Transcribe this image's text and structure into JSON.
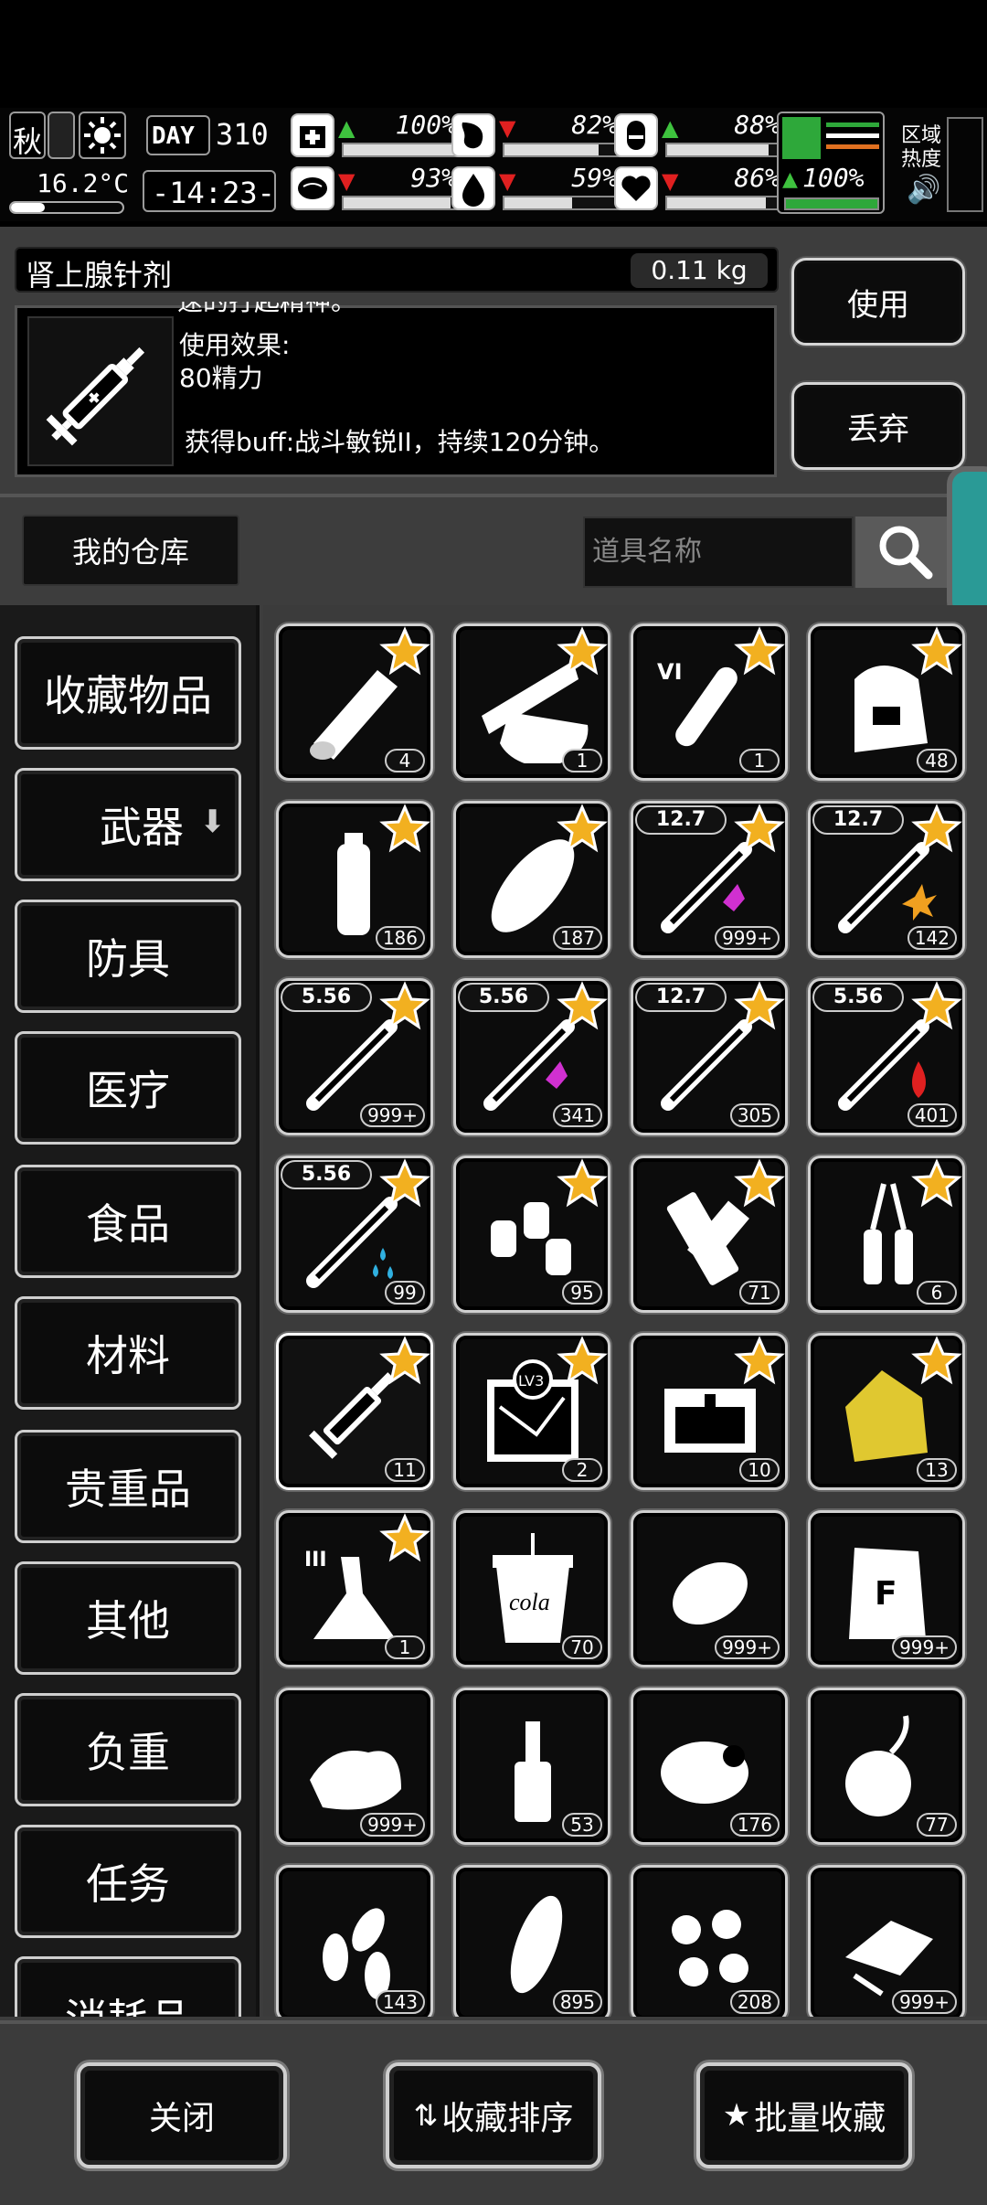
{
  "status": {
    "season": "秋",
    "weather_icon": "sun-icon",
    "temperature": "16.2°C",
    "day_label": "DAY",
    "day": "310",
    "time": "-14:23-",
    "stats": [
      {
        "name": "health",
        "icon": "medkit-icon",
        "trend": "up",
        "value": "100%",
        "fill": 1.0
      },
      {
        "name": "hunger",
        "icon": "stomach-icon",
        "trend": "down",
        "value": "82%",
        "fill": 0.82
      },
      {
        "name": "pill",
        "icon": "pill-icon",
        "trend": "up",
        "value": "88%",
        "fill": 0.88
      },
      {
        "name": "brain",
        "icon": "brain-icon",
        "trend": "down",
        "value": "93%",
        "fill": 0.93
      },
      {
        "name": "water",
        "icon": "water-drop-icon",
        "trend": "down",
        "value": "59%",
        "fill": 0.59
      },
      {
        "name": "mood",
        "icon": "heart-icon",
        "trend": "down",
        "value": "86%",
        "fill": 0.86
      }
    ],
    "stamina": {
      "value": "100%",
      "fill": 1.0
    },
    "zone_label_1": "区域",
    "zone_label_2": "热度"
  },
  "item": {
    "name": "肾上腺针剂",
    "weight": "0.11 kg",
    "desc_partial": "速的打起精神。",
    "effect_label": "使用效果:",
    "effect_value": "80精力",
    "buff": "获得buff:战斗敏锐II，持续120分钟。",
    "use_label": "使用",
    "discard_label": "丢弃"
  },
  "search": {
    "warehouse_label": "我的仓库",
    "placeholder": "道具名称"
  },
  "categories": [
    "收藏物品",
    "武器",
    "防具",
    "医疗",
    "食品",
    "材料",
    "贵重品",
    "其他",
    "负重",
    "任务",
    "消耗品"
  ],
  "grid": [
    {
      "icon": "wood-log-icon",
      "count": "4",
      "star": true
    },
    {
      "icon": "wood-planks-icon",
      "count": "1",
      "star": true
    },
    {
      "icon": "test-tube-icon",
      "count": "1",
      "star": true,
      "tag": "VI"
    },
    {
      "icon": "backpack-icon",
      "count": "48",
      "star": true
    },
    {
      "icon": "water-bottle-icon",
      "count": "186",
      "star": true
    },
    {
      "icon": "bread-icon",
      "count": "187",
      "star": true
    },
    {
      "icon": "bullet-icon",
      "count": "999+",
      "star": true,
      "caliber": "12.7",
      "effect": "purple"
    },
    {
      "icon": "bullet-icon",
      "count": "142",
      "star": true,
      "caliber": "12.7",
      "effect": "explosive"
    },
    {
      "icon": "bullet-icon",
      "count": "999+",
      "star": true,
      "caliber": "5.56"
    },
    {
      "icon": "bullet-icon",
      "count": "341",
      "star": true,
      "caliber": "5.56",
      "effect": "purple"
    },
    {
      "icon": "bullet-icon",
      "count": "305",
      "star": true,
      "caliber": "12.7"
    },
    {
      "icon": "bullet-icon",
      "count": "401",
      "star": true,
      "caliber": "5.56",
      "effect": "fire"
    },
    {
      "icon": "bullet-icon",
      "count": "99",
      "star": true,
      "caliber": "5.56",
      "effect": "water"
    },
    {
      "icon": "bottles-icon",
      "count": "95",
      "star": true
    },
    {
      "icon": "bandage-icon",
      "count": "71",
      "star": true
    },
    {
      "icon": "ampoule-icon",
      "count": "6",
      "star": true
    },
    {
      "icon": "syringe-icon",
      "count": "11",
      "star": true,
      "selected": true
    },
    {
      "icon": "map-icon",
      "count": "2",
      "star": true,
      "tag": "LV3"
    },
    {
      "icon": "chest-icon",
      "count": "10",
      "star": true
    },
    {
      "icon": "gold-ore-icon",
      "count": "13",
      "star": true
    },
    {
      "icon": "flask-icon",
      "count": "1",
      "star": true,
      "tag": "III"
    },
    {
      "icon": "cola-cup-icon",
      "count": "70",
      "star": false,
      "label": "cola"
    },
    {
      "icon": "potato-icon",
      "count": "999+",
      "star": false
    },
    {
      "icon": "flour-bag-icon",
      "count": "999+",
      "star": false,
      "label": "F"
    },
    {
      "icon": "cloth-icon",
      "count": "999+",
      "star": false
    },
    {
      "icon": "liquor-bottle-icon",
      "count": "53",
      "star": false
    },
    {
      "icon": "meat-icon",
      "count": "176",
      "star": false
    },
    {
      "icon": "onion-icon",
      "count": "77",
      "star": false
    },
    {
      "icon": "seeds-icon",
      "count": "143",
      "star": false
    },
    {
      "icon": "corn-icon",
      "count": "895",
      "star": false
    },
    {
      "icon": "beans-icon",
      "count": "208",
      "star": false
    },
    {
      "icon": "scrap-icon",
      "count": "999+",
      "star": false
    }
  ],
  "bottom": {
    "close_label": "关闭",
    "sort_label": "收藏排序",
    "batch_label": "批量收藏"
  }
}
